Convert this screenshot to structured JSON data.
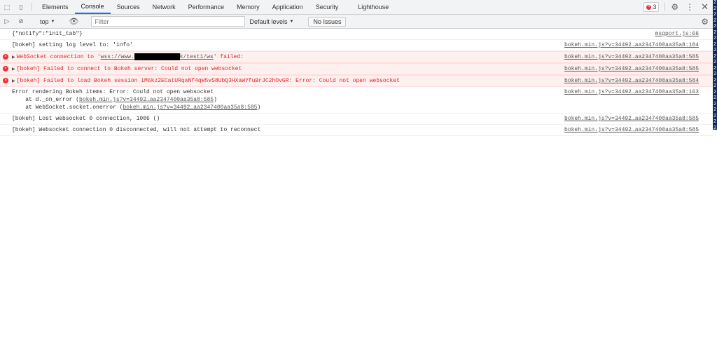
{
  "tabs": [
    "Elements",
    "Console",
    "Sources",
    "Network",
    "Performance",
    "Memory",
    "Application",
    "Security",
    "Lighthouse"
  ],
  "active_tab": "Console",
  "error_count": "3",
  "toolbar": {
    "context": "top",
    "filter_placeholder": "Filter",
    "levels": "Default levels",
    "issues": "No Issues"
  },
  "messages": [
    {
      "text": "{\"notify\":\"init_tab\"}",
      "source": "msgport.js:66"
    },
    {
      "text": "[bokeh] setting log level to: 'info'",
      "source": "bokeh.min.js?v=34492…aa2347400aa35a8:184"
    },
    {
      "prefix": "WebSocket connection to '",
      "url_a": "wss://www.",
      "url_b": "k/test1/ws",
      "suffix": "' failed:",
      "source": "bokeh.min.js?v=34492…aa2347400aa35a8:585"
    },
    {
      "text": "[bokeh] Failed to connect to Bokeh server: Could not open websocket",
      "source": "bokeh.min.js?v=34492…aa2347400aa35a8:585"
    },
    {
      "text": "[bokeh] Failed to load Bokeh session iM6kz2ECatURqaNf4qW5vS8UbQ3HXaWYfuBrJC2hOvGR: Error: Could not open websocket",
      "source": "bokeh.min.js?v=34492…aa2347400aa35a8:584"
    },
    {
      "text": "Error rendering Bokeh items: Error: Could not open websocket",
      "stack1_prefix": "    at d._on_error (",
      "stack1_link": "bokeh.min.js?v=34492…aa2347400aa35a8:585",
      "stack2_prefix": "    at WebSocket.socket.onerror (",
      "stack2_link": "bokeh.min.js?v=34492…aa2347400aa35a8:585",
      "close": ")",
      "source": "bokeh.min.js?v=34492…aa2347400aa35a8:163"
    },
    {
      "text": "[bokeh] Lost websocket 0 connection, 1006 ()",
      "source": "bokeh.min.js?v=34492…aa2347400aa35a8:585"
    },
    {
      "text": "[bokeh] Websocket connection 0 disconnected, will not attempt to reconnect",
      "source": "bokeh.min.js?v=34492…aa2347400aa35a8:585"
    }
  ],
  "edge_strip": "2 2 2 2 2 2 2 2 2 2 2 2 2 2 2 2 2 2 2 2 2 2"
}
